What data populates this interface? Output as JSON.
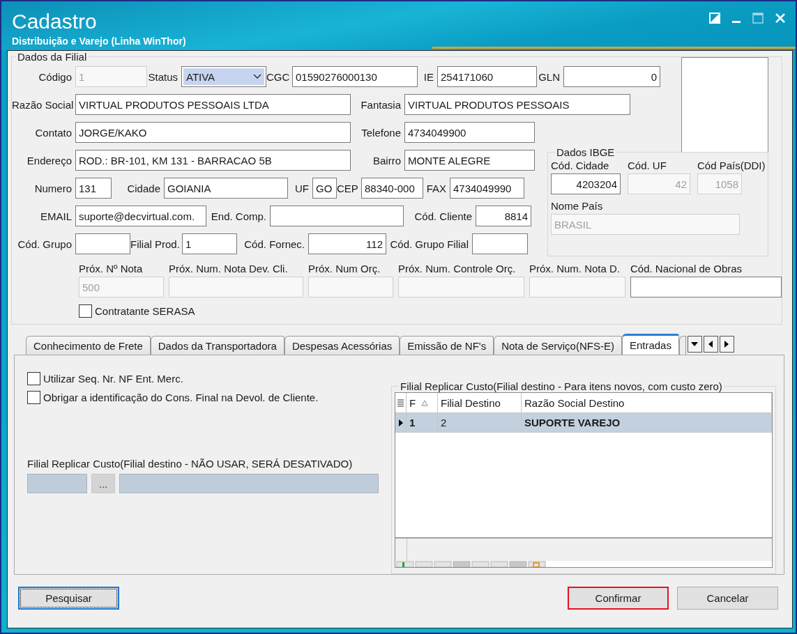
{
  "window": {
    "title": "Cadastro",
    "subtitle": "Distribuição e Varejo (Linha WinThor)"
  },
  "branch": {
    "legend": "Dados da Filial",
    "rows": [
      {
        "fields": [
          {
            "label": "Código",
            "value": "1",
            "kind": "text",
            "disabled": true
          },
          {
            "label": "Status",
            "value": "ATIVA",
            "kind": "select",
            "disabled": false
          },
          {
            "label": "CGC",
            "value": "01590276000130",
            "kind": "text",
            "disabled": false
          },
          {
            "label": "IE",
            "value": "254171060",
            "kind": "text",
            "disabled": false
          },
          {
            "label": "GLN",
            "value": "0",
            "kind": "text",
            "disabled": false
          }
        ]
      },
      {
        "fields": [
          {
            "label": "Razão Social",
            "value": "VIRTUAL PRODUTOS PESSOAIS LTDA",
            "kind": "text",
            "disabled": false
          },
          {
            "label": "Fantasia",
            "value": "VIRTUAL PRODUTOS PESSOAIS",
            "kind": "text",
            "disabled": false
          }
        ]
      },
      {
        "fields": [
          {
            "label": "Contato",
            "value": "JORGE/KAKO",
            "kind": "text",
            "disabled": false
          },
          {
            "label": "Telefone",
            "value": "4734049900",
            "kind": "text",
            "disabled": false
          }
        ]
      },
      {
        "fields": [
          {
            "label": "Endereço",
            "value": "ROD.: BR-101, KM 131 - BARRACAO 5B",
            "kind": "text",
            "disabled": false
          },
          {
            "label": "Bairro",
            "value": "MONTE ALEGRE",
            "kind": "text",
            "disabled": false
          }
        ]
      },
      {
        "fields": [
          {
            "label": "Numero",
            "value": "131",
            "kind": "text",
            "disabled": false
          },
          {
            "label": "Cidade",
            "value": "GOIANIA",
            "kind": "text",
            "disabled": false
          },
          {
            "label": "UF",
            "value": "GO",
            "kind": "text",
            "disabled": false
          },
          {
            "label": "CEP",
            "value": "88340-000",
            "kind": "text",
            "disabled": false
          },
          {
            "label": "FAX",
            "value": "4734049990",
            "kind": "text",
            "disabled": false
          }
        ]
      },
      {
        "fields": [
          {
            "label": "EMAIL",
            "value": "suporte@decvirtual.com.",
            "kind": "text",
            "disabled": false
          },
          {
            "label": "End. Comp.",
            "kind": "text",
            "disabled": false
          },
          {
            "label": "Cód. Cliente",
            "value": "8814",
            "kind": "text",
            "disabled": false
          }
        ]
      },
      {
        "fields": [
          {
            "label": "Cód. Grupo",
            "kind": "text",
            "disabled": false
          },
          {
            "label": "Filial Prod.",
            "value": "1",
            "kind": "text",
            "disabled": false
          },
          {
            "label": "Cód. Fornec.",
            "value": "112",
            "kind": "text",
            "disabled": false
          },
          {
            "label": "Cód. Grupo Filial",
            "kind": "text",
            "disabled": false
          }
        ]
      }
    ],
    "ibge": {
      "legend": "Dados IBGE",
      "fields": [
        {
          "label": "Cód. Cidade",
          "value": "4203204",
          "disabled": false
        },
        {
          "label": "Cód. UF",
          "value": "42",
          "disabled": true
        },
        {
          "label": "Cód País(DDI)",
          "value": "1058",
          "disabled": true
        }
      ],
      "country": {
        "label": "Nome País",
        "value": "BRASIL",
        "disabled": true
      }
    },
    "next_numbers": [
      {
        "label": "Próx. Nº Nota",
        "value": "500",
        "disabled": true
      },
      {
        "label": "Próx. Num. Nota Dev. Cli.",
        "disabled": true
      },
      {
        "label": "Próx. Num Orç.",
        "disabled": true
      },
      {
        "label": "Próx. Num. Controle Orç.",
        "disabled": true
      },
      {
        "label": "Próx. Num. Nota D.",
        "disabled": true
      },
      {
        "label": "Cód. Nacional de Obras",
        "disabled": false
      }
    ],
    "serasa": {
      "label": "Contratante SERASA",
      "checked": false
    }
  },
  "tabs": [
    {
      "label": "Conhecimento de Frete",
      "selected": false
    },
    {
      "label": "Dados da Transportadora",
      "selected": false
    },
    {
      "label": "Despesas Acessórias",
      "selected": false
    },
    {
      "label": "Emissão de NF's",
      "selected": false
    },
    {
      "label": "Nota de Serviço(NFS-E)",
      "selected": false
    },
    {
      "label": "Entradas",
      "selected": true
    }
  ],
  "entradas": {
    "checkboxes": [
      {
        "label": "Utilizar Seq. Nr. NF Ent. Merc.",
        "checked": false
      },
      {
        "label": "Obrigar a identificação do Cons. Final na Devol. de Cliente.",
        "checked": false
      }
    ],
    "legacy_replicate": {
      "label": "Filial Replicar Custo(Filial destino - NÃO USAR, SERÁ DESATIVADO)",
      "browse_button": "..."
    },
    "replicate": {
      "legend": "Filial Replicar Custo(Filial destino - Para itens novos, com custo zero)",
      "columns": [
        "F",
        "Filial Destino",
        "Razão Social Destino"
      ],
      "rows": [
        {
          "cells": [
            "1",
            "2",
            "SUPORTE VAREJO"
          ],
          "selected": true
        }
      ]
    }
  },
  "buttons": [
    {
      "label": "Pesquisar",
      "focused": true,
      "highlighted": false
    },
    {
      "label": "Confirmar",
      "focused": false,
      "highlighted": true
    },
    {
      "label": "Cancelar",
      "focused": false,
      "highlighted": false
    }
  ]
}
